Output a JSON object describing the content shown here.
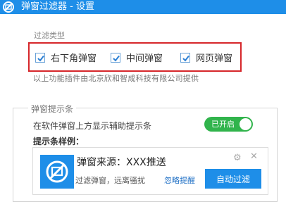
{
  "window": {
    "title": "弹窗过滤器 - 设置"
  },
  "filter": {
    "section_label": "过滤类型",
    "options": [
      {
        "label": "右下角弹窗",
        "checked": true
      },
      {
        "label": "中间弹窗",
        "checked": true
      },
      {
        "label": "网页弹窗",
        "checked": true
      }
    ],
    "credit_text": "以上功能插件由北京欣和智成科技有限公司提供"
  },
  "tips": {
    "group_title": "弹窗提示条",
    "row_text": "在软件弹窗上方显示辅助提示条",
    "toggle_label": "已开启",
    "toggle_on": true,
    "example_label": "提示条样例：",
    "sample": {
      "title": "弹窗来源：XXX推送",
      "subtitle": "过滤弹窗，远离骚扰",
      "ignore_link": "忽略提醒",
      "auto_button": "自动过滤"
    }
  },
  "colors": {
    "titlebar": "#1e8ee8",
    "highlight": "#d6262a",
    "toggle": "#31b44c"
  }
}
